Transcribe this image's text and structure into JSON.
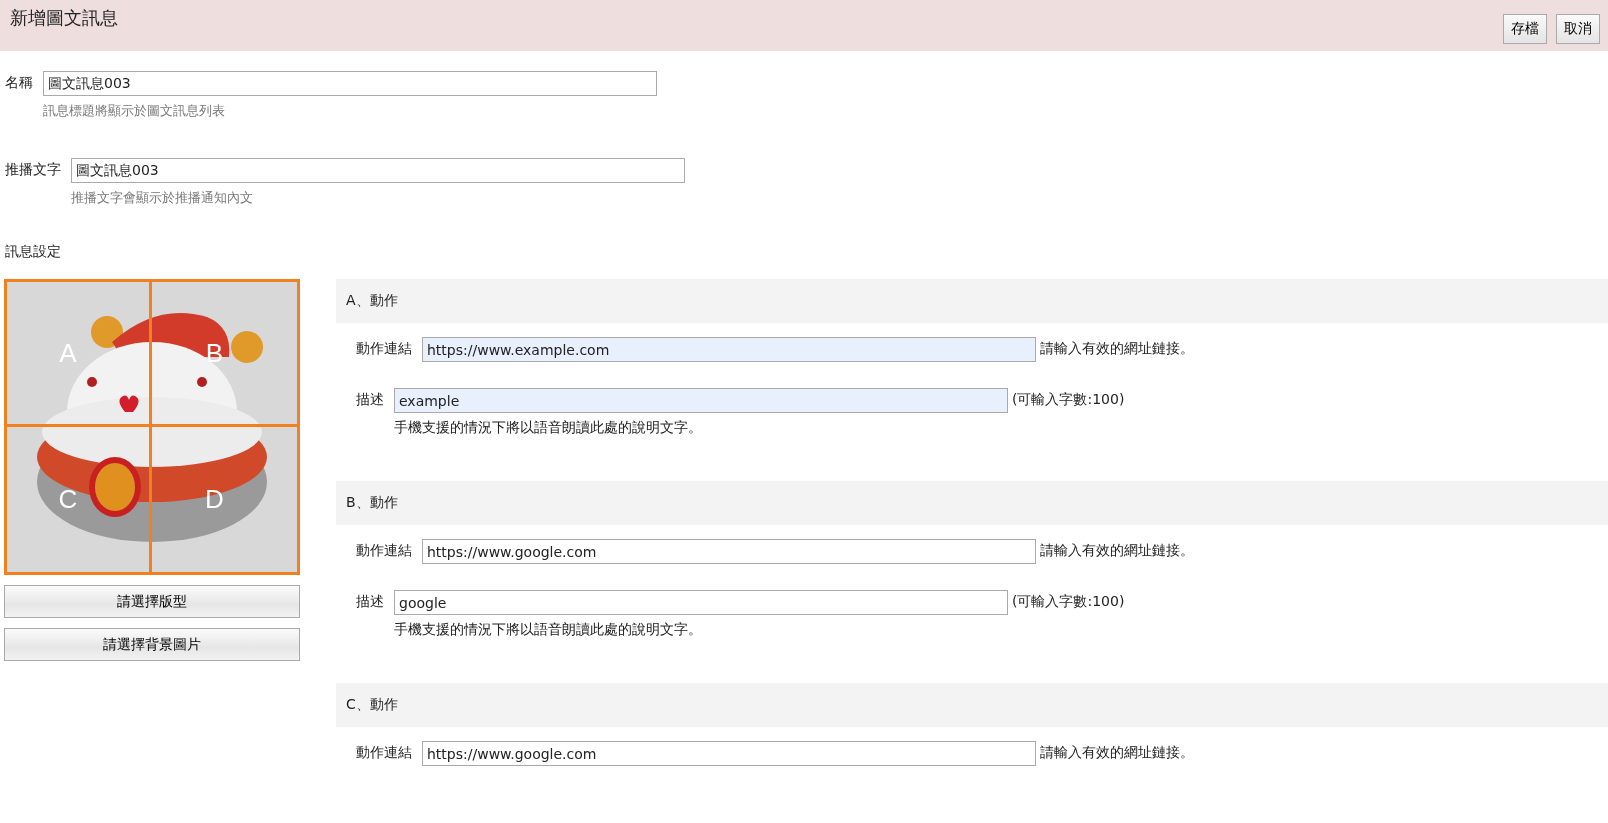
{
  "header": {
    "title": "新增圖文訊息",
    "buttons": [
      "存檔",
      "取消"
    ]
  },
  "fields": [
    {
      "label": "名稱",
      "value": "圖文訊息003",
      "hint": "訊息標題將顯示於圖文訊息列表"
    },
    {
      "label": "推播文字",
      "value": "圖文訊息003",
      "hint": "推播文字會顯示於推播通知內文"
    }
  ],
  "message_settings": {
    "title": "訊息設定",
    "image_regions": [
      "A",
      "B",
      "C",
      "D"
    ],
    "buttons": [
      "請選擇版型",
      "請選擇背景圖片"
    ],
    "actions": [
      {
        "heading": "A、動作",
        "link": {
          "label": "動作連結",
          "value": "https://www.example.com",
          "autofilled": true,
          "note": "請輸入有效的網址鏈接。"
        },
        "description": {
          "label": "描述",
          "value": "example",
          "autofilled": true,
          "note": "(可輸入字數:100)",
          "hint": "手機支援的情況下將以語音朗讀此處的說明文字。"
        }
      },
      {
        "heading": "B、動作",
        "link": {
          "label": "動作連結",
          "value": "https://www.google.com",
          "autofilled": false,
          "note": "請輸入有效的網址鏈接。"
        },
        "description": {
          "label": "描述",
          "value": "google",
          "autofilled": false,
          "note": "(可輸入字數:100)",
          "hint": "手機支援的情況下將以語音朗讀此處的說明文字。"
        }
      },
      {
        "heading": "C、動作",
        "link": {
          "label": "動作連結",
          "value": "https://www.google.com",
          "autofilled": false,
          "note": "請輸入有效的網址鏈接。"
        }
      }
    ]
  }
}
